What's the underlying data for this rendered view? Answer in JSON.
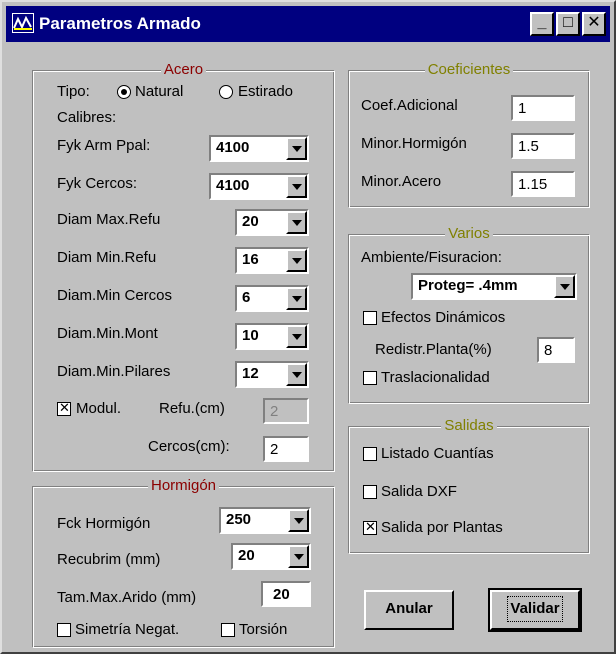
{
  "window": {
    "title": "Parametros Armado",
    "controls": {
      "minimize": "_",
      "maximize": "□",
      "close": "✕"
    },
    "icon": "beam-icon"
  },
  "acero": {
    "legend": "Acero",
    "tipo_label": "Tipo:",
    "natural_label": "Natural",
    "estirado_label": "Estirado",
    "tipo_selected": "Natural",
    "calibres_label": "Calibres:",
    "fyk_ppal": {
      "label": "Fyk Arm Ppal:",
      "value": "4100"
    },
    "fyk_cercos": {
      "label": "Fyk Cercos:",
      "value": "4100"
    },
    "diam_max_refu": {
      "label": "Diam Max.Refu",
      "value": "20"
    },
    "diam_min_refu": {
      "label": "Diam Min.Refu",
      "value": "16"
    },
    "diam_min_cercos": {
      "label": "Diam.Min Cercos",
      "value": "6"
    },
    "diam_min_mont": {
      "label": "Diam.Min.Mont",
      "value": "10"
    },
    "diam_min_pilares": {
      "label": "Diam.Min.Pilares",
      "value": "12"
    },
    "modul": {
      "label": "Modul.",
      "checked": true
    },
    "refu_cm": {
      "label": "Refu.(cm)",
      "value": "2"
    },
    "cercos_cm": {
      "label": "Cercos(cm):",
      "value": "2"
    }
  },
  "hormigon": {
    "legend": "Hormigón",
    "fck": {
      "label": "Fck Hormigón",
      "value": "250"
    },
    "recubrim": {
      "label": "Recubrim (mm)",
      "value": "20"
    },
    "tam_max_arido": {
      "label": "Tam.Max.Arido (mm)",
      "value": "20"
    },
    "simetria": {
      "label": "Simetría Negat.",
      "checked": false
    },
    "torsion": {
      "label": "Torsión",
      "checked": false
    }
  },
  "coeficientes": {
    "legend": "Coeficientes",
    "adicional": {
      "label": "Coef.Adicional",
      "value": "1"
    },
    "minor_hormigon": {
      "label": "Minor.Hormigón",
      "value": "1.5"
    },
    "minor_acero": {
      "label": "Minor.Acero",
      "value": "1.15"
    }
  },
  "varios": {
    "legend": "Varios",
    "ambiente_label": "Ambiente/Fisuracion:",
    "ambiente_value": "Proteg= .4mm",
    "efectos": {
      "label": "Efectos Dinámicos",
      "checked": false
    },
    "redistr": {
      "label": "Redistr.Planta(%)",
      "value": "8"
    },
    "traslacionalidad": {
      "label": "Traslacionalidad",
      "checked": false
    }
  },
  "salidas": {
    "legend": "Salidas",
    "listado": {
      "label": "Listado Cuantías",
      "checked": false
    },
    "dxf": {
      "label": "Salida DXF",
      "checked": false
    },
    "plantas": {
      "label": "Salida por Plantas",
      "checked": true
    }
  },
  "buttons": {
    "anular": "Anular",
    "validar": "Validar"
  },
  "colors": {
    "titlebar": "#000080",
    "face": "#c0c0c0",
    "legend_red": "#8b0000",
    "legend_olive": "#808000"
  }
}
